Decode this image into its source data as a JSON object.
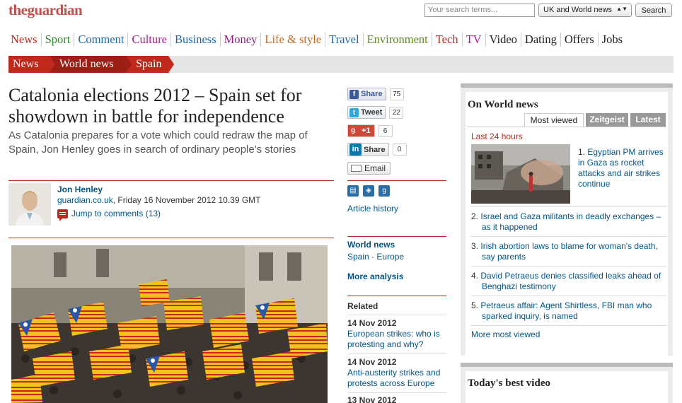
{
  "header": {
    "logo_the": "the",
    "logo_guardian": "guardian",
    "search_placeholder": "Your search terms...",
    "edition": "UK and World news",
    "search_button": "Search"
  },
  "nav": [
    {
      "label": "News",
      "color": "#c0281c"
    },
    {
      "label": "Sport",
      "color": "#2f8a2f"
    },
    {
      "label": "Comment",
      "color": "#1e6aa8"
    },
    {
      "label": "Culture",
      "color": "#b5198d"
    },
    {
      "label": "Business",
      "color": "#1e6aa8"
    },
    {
      "label": "Money",
      "color": "#8b1e8b"
    },
    {
      "label": "Life & style",
      "color": "#c46a1e"
    },
    {
      "label": "Travel",
      "color": "#1e6aa8"
    },
    {
      "label": "Environment",
      "color": "#5e8a1e"
    },
    {
      "label": "Tech",
      "color": "#c0281c"
    },
    {
      "label": "TV",
      "color": "#b5198d"
    },
    {
      "label": "Video",
      "color": "#222222"
    },
    {
      "label": "Dating",
      "color": "#222222"
    },
    {
      "label": "Offers",
      "color": "#222222"
    },
    {
      "label": "Jobs",
      "color": "#222222"
    }
  ],
  "breadcrumbs": [
    "News",
    "World news",
    "Spain"
  ],
  "article": {
    "headline": "Catalonia elections 2012 – Spain set for showdown in battle for independence",
    "standfirst": "As Catalonia prepares for a vote which could redraw the map of Spain, Jon Henley goes in search of ordinary people's stories",
    "author": "Jon Henley",
    "source": "guardian.co.uk",
    "date": ", Friday 16 November 2012 10.39 GMT",
    "comments_link": "Jump to comments (13)"
  },
  "share": {
    "facebook": {
      "label": "Share",
      "count": "75"
    },
    "twitter": {
      "label": "Tweet",
      "count": "22"
    },
    "gplus": {
      "label": "+1",
      "count": "6"
    },
    "linkedin": {
      "label": "Share",
      "count": "0"
    },
    "email": {
      "label": "Email"
    }
  },
  "sidebar": {
    "article_history": "Article history",
    "world_news": "World news",
    "spain": "Spain",
    "europe": "Europe",
    "separator": " · ",
    "more_analysis": "More analysis",
    "related_heading": "Related",
    "related": [
      {
        "date": "14 Nov 2012",
        "title": "European strikes: who is protesting and why?"
      },
      {
        "date": "14 Nov 2012",
        "title": "Anti-austerity strikes and protests across Europe"
      },
      {
        "date": "13 Nov 2012",
        "title": ""
      }
    ]
  },
  "world_panel": {
    "title": "On World news",
    "tabs": [
      "Most viewed",
      "Zeitgeist",
      "Latest"
    ],
    "period": "Last 24 hours",
    "items": [
      {
        "num": "1.",
        "title": "Egyptian PM arrives in Gaza as rocket attacks and air strikes continue"
      },
      {
        "num": "2.",
        "title": "Israel and Gaza militants in deadly exchanges – as it happened"
      },
      {
        "num": "3.",
        "title": "Irish abortion laws to blame for woman's death, say parents"
      },
      {
        "num": "4.",
        "title": "David Petraeus denies classified leaks ahead of Benghazi testimony"
      },
      {
        "num": "5.",
        "title": "Petraeus affair: Agent Shirtless, FBI man who sparked inquiry, is named"
      }
    ],
    "more": "More most viewed"
  },
  "video_panel": {
    "title": "Today's best video"
  }
}
